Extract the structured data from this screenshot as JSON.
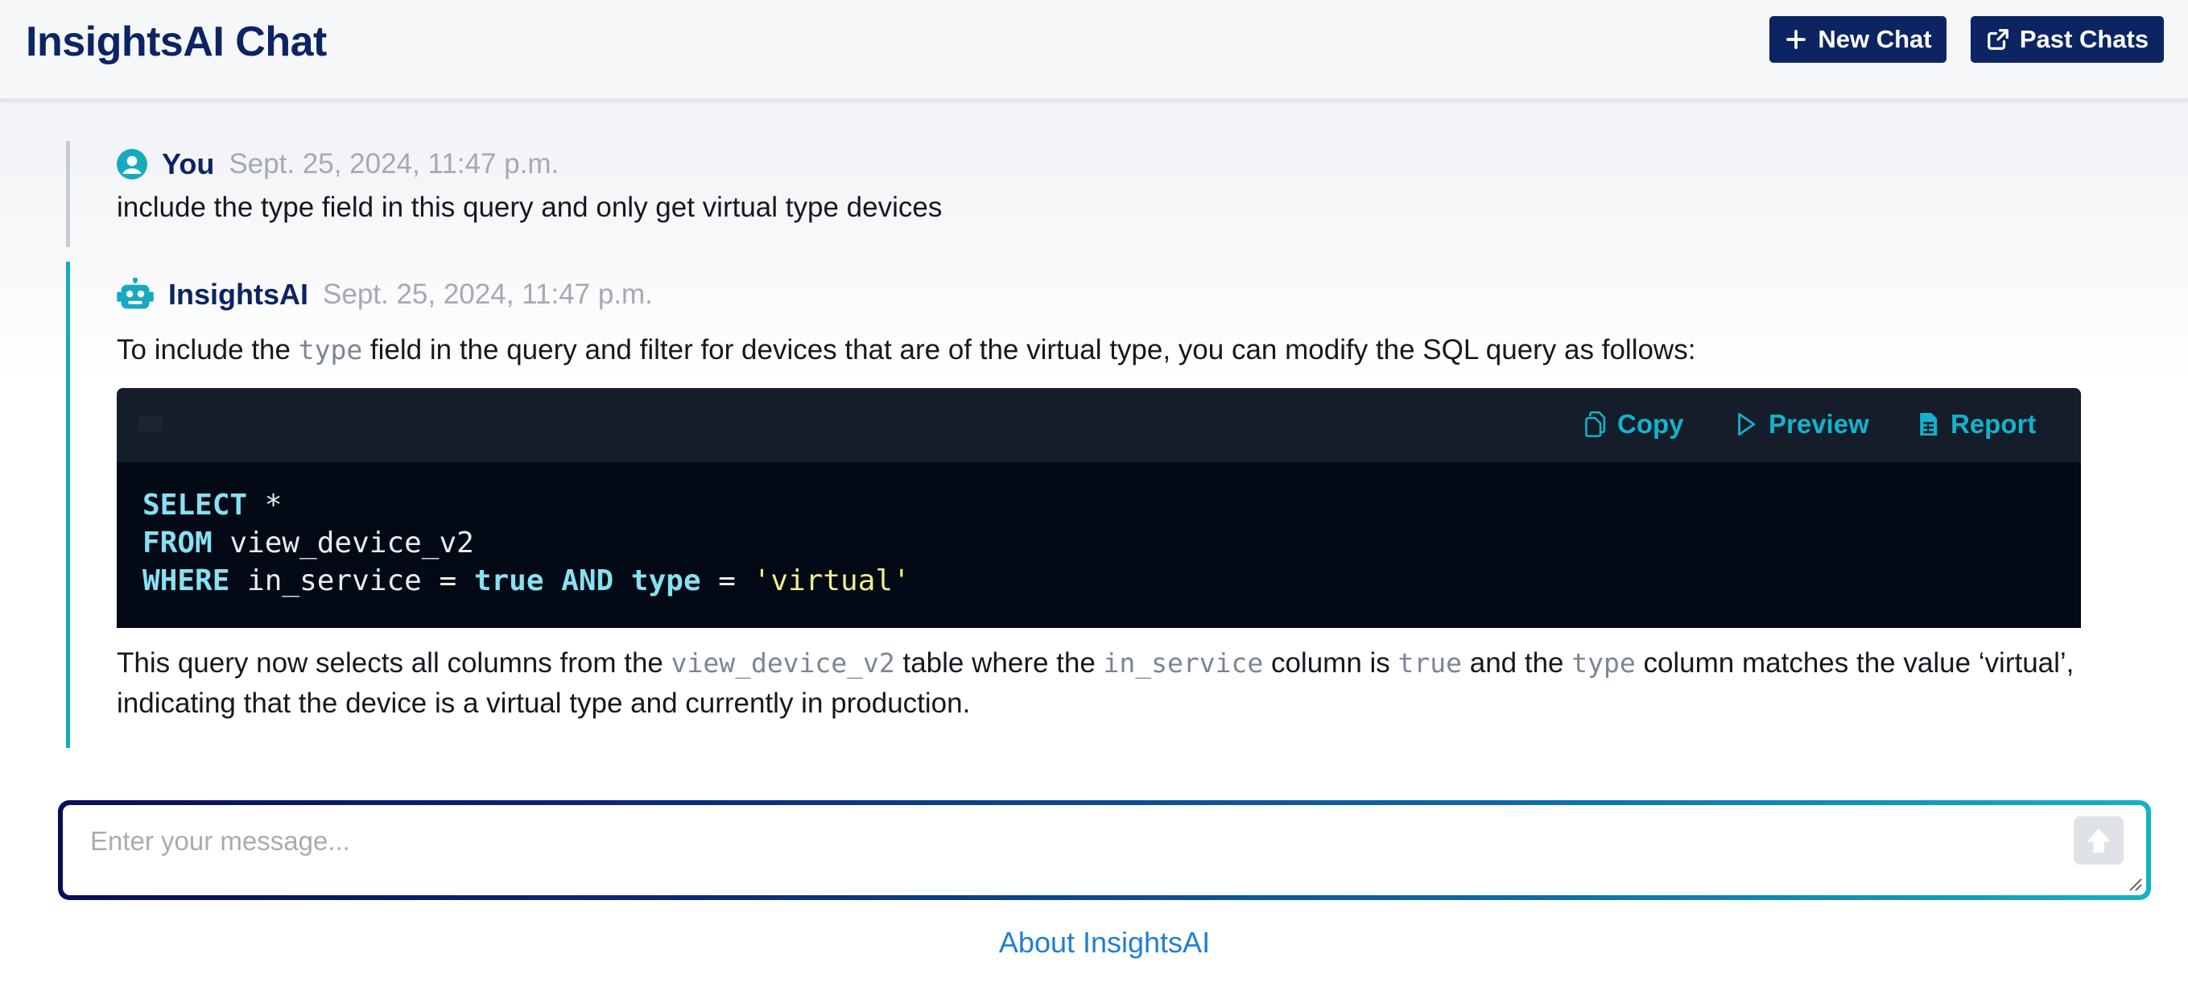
{
  "header": {
    "title": "InsightsAI Chat",
    "new_chat_label": "New Chat",
    "past_chats_label": "Past Chats"
  },
  "messages": [
    {
      "author": "You",
      "timestamp": "Sept. 25, 2024, 11:47 p.m.",
      "text": "include the type field in this query and only get virtual type devices"
    },
    {
      "author": "InsightsAI",
      "timestamp": "Sept. 25, 2024, 11:47 p.m.",
      "intro": {
        "before": "To include the ",
        "code": "type",
        "after": " field in the query and filter for devices that are of the virtual type, you can modify the SQL query as follows:"
      },
      "code_toolbar": {
        "copy_label": "Copy",
        "preview_label": "Preview",
        "report_label": "Report"
      },
      "code_lines": {
        "l1_kw": "SELECT",
        "l1_rest": " *",
        "l2_kw": "FROM",
        "l2_rest": " view_device_v2",
        "l3_kw1": "WHERE",
        "l3_mid1": " in_service = ",
        "l3_kw2": "true",
        "l3_sp1": " ",
        "l3_kw3": "AND",
        "l3_sp2": " ",
        "l3_kw4": "type",
        "l3_mid2": " = ",
        "l3_str": "'virtual'"
      },
      "outro": {
        "p1": "This query now selects all columns from the ",
        "c1": "view_device_v2",
        "p2": " table where the ",
        "c2": "in_service",
        "p3": " column is ",
        "c3": "true",
        "p4": " and the ",
        "c4": "type",
        "p5": " column matches the value ‘virtual’, indicating that the device is a virtual type and currently in production."
      }
    }
  ],
  "input": {
    "placeholder": "Enter your message..."
  },
  "footer": {
    "about_label": "About InsightsAI"
  },
  "icons": {
    "user": "user-circle-icon",
    "bot": "robot-icon",
    "new_chat": "plus-icon",
    "past_chats": "external-link-icon",
    "copy": "copy-icon",
    "preview": "play-icon",
    "report": "document-icon",
    "send": "arrow-up-icon"
  },
  "colors": {
    "brand": "#0d2463",
    "accent": "#12b3cc",
    "link": "#1f7fd6"
  }
}
